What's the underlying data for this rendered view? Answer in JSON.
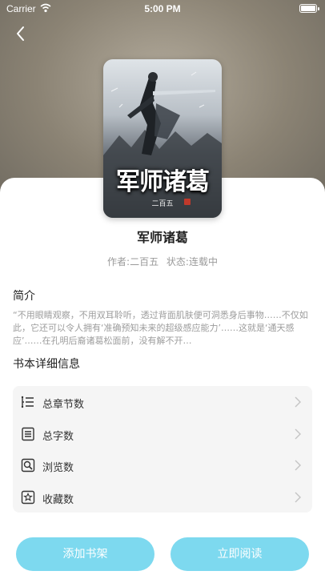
{
  "status_bar": {
    "carrier": "Carrier",
    "time": "5:00 PM"
  },
  "nav": {
    "back_icon": "chevron-left-icon"
  },
  "cover": {
    "title": "军师诸葛",
    "author": "二百五"
  },
  "book": {
    "title": "军师诸葛",
    "author": "作者:二百五",
    "status": "状态:连载中"
  },
  "intro": {
    "heading": "简介",
    "text": "“不用眼睛观察，不用双耳聆听，透过背面肌肤便可洞悉身后事物……不仅如此，它还可以令人拥有‘准确预知未来的超级感应能力’……这就是‘通天感应’……在孔明后裔诸葛松面前，没有解不开…"
  },
  "details": {
    "heading": "书本详细信息",
    "rows": [
      {
        "label": "总章节数",
        "icon": "chapter-list-icon"
      },
      {
        "label": "总字数",
        "icon": "document-icon"
      },
      {
        "label": "浏览数",
        "icon": "search-icon"
      },
      {
        "label": "收藏数",
        "icon": "star-icon"
      }
    ]
  },
  "actions": {
    "add_label": "添加书架",
    "read_label": "立即阅读"
  },
  "colors": {
    "accent": "#7dd9ef",
    "card_bg": "#f5f5f5",
    "muted_text": "#9a9a9a"
  }
}
